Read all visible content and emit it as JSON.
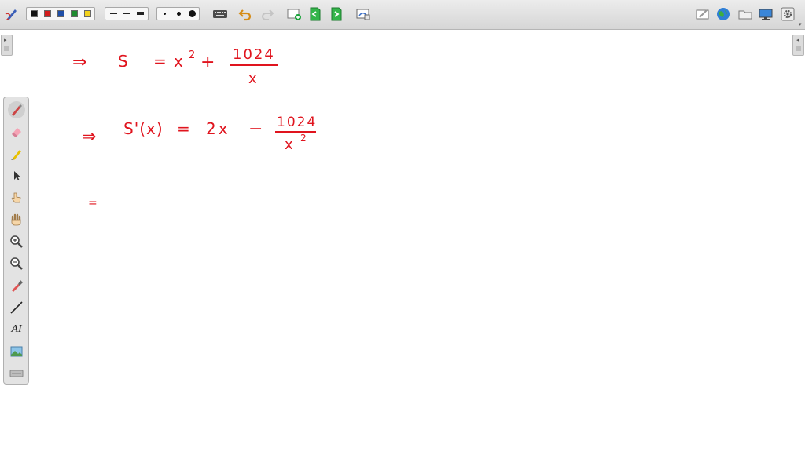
{
  "toolbar": {
    "pen_colors": [
      "#111111",
      "#d21d1d",
      "#1f4fa8",
      "#1e8a2f",
      "#f2d11b"
    ],
    "accent_color": "#1aa33a",
    "icons": {
      "pen": "pen-settings-icon",
      "keyboard": "keyboard-icon",
      "undo": "undo-icon",
      "redo": "redo-icon",
      "new_page": "new-page-icon",
      "page_prev": "page-prev-icon",
      "page_next": "page-next-icon",
      "screen_capture": "screen-capture-icon",
      "board_color": "board-color-icon",
      "globe": "globe-icon",
      "folder": "folder-icon",
      "monitor": "monitor-icon",
      "settings": "settings-icon"
    }
  },
  "palette": {
    "tools": [
      "pen-icon",
      "eraser-icon",
      "highlighter-icon",
      "select-arrow-icon",
      "touch-hand-icon",
      "grab-hand-icon",
      "zoom-in-icon",
      "zoom-out-icon",
      "color-picker-icon",
      "line-icon",
      "text-tool-icon",
      "image-icon",
      "keyboard-icon"
    ],
    "text_tool_label": "AI"
  },
  "ink": {
    "color": "#e0141e",
    "line1": {
      "arrow": "⇒",
      "lhs": "S",
      "eq": "=",
      "term": "x",
      "exp": "2",
      "plus": "+",
      "num": "1024",
      "den": "x"
    },
    "line2": {
      "arrow": "⇒",
      "lhs": "S'(x)",
      "eq": "=",
      "term": "2x",
      "minus": "−",
      "num": "1024",
      "den": "x",
      "exp": "2"
    },
    "line3": {
      "mark": "="
    }
  }
}
